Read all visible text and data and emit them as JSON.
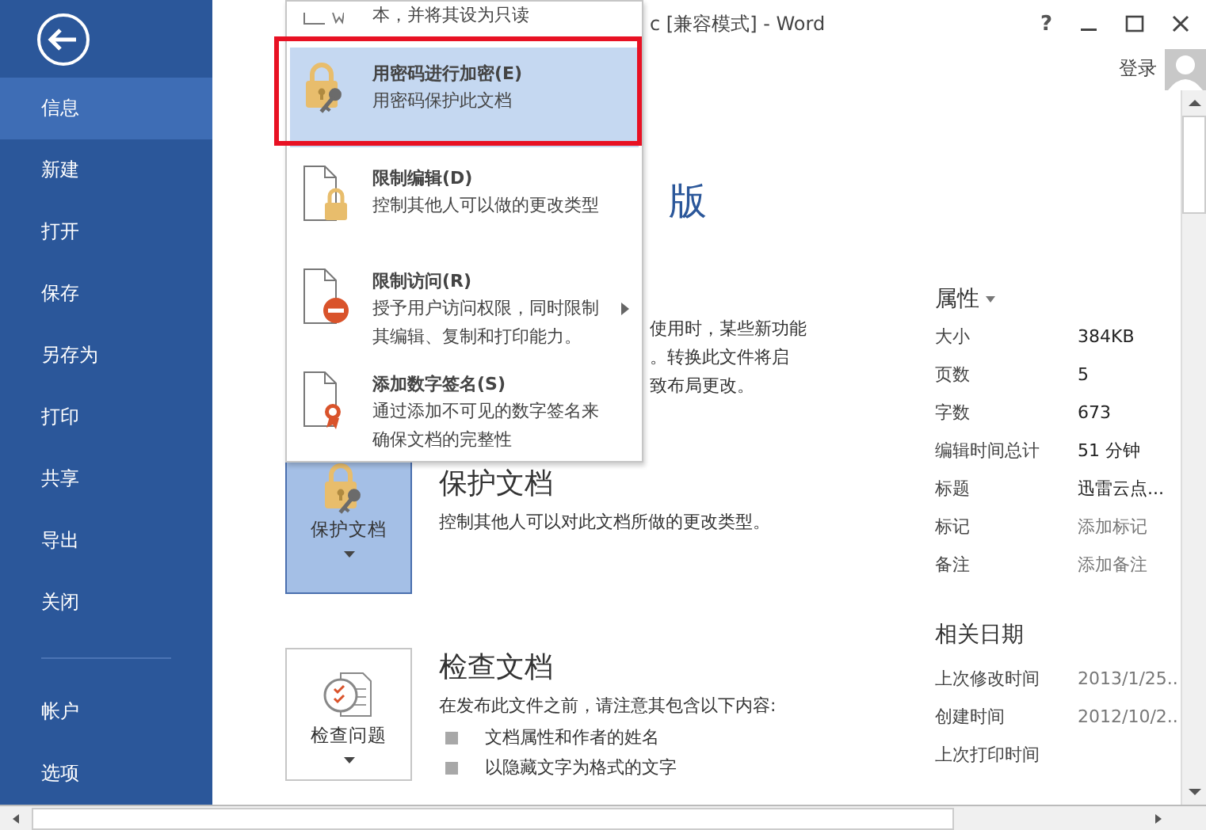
{
  "window": {
    "title": "c [兼容模式] - Word",
    "controls": [
      {
        "kind": "help",
        "label": "?"
      },
      {
        "kind": "minimize"
      },
      {
        "kind": "maximize"
      },
      {
        "kind": "close"
      }
    ],
    "sign_in": "登录"
  },
  "sidebar": {
    "items": [
      {
        "label": "信息",
        "selected": true
      },
      {
        "label": "新建",
        "selected": false
      },
      {
        "label": "打开",
        "selected": false
      },
      {
        "label": "保存",
        "selected": false
      },
      {
        "label": "另存为",
        "selected": false
      },
      {
        "label": "打印",
        "selected": false
      },
      {
        "label": "共享",
        "selected": false
      },
      {
        "label": "导出",
        "selected": false
      },
      {
        "label": "关闭",
        "selected": false
      },
      {
        "label": "帐户",
        "selected": false
      },
      {
        "label": "选项",
        "selected": false
      }
    ]
  },
  "heading_fragment": "版",
  "compat_text": [
    "使用时，某些新功能",
    "。转换此文件将启",
    "致布局更改。"
  ],
  "sections": [
    {
      "button": "保护文档",
      "selected": true,
      "title": "保护文档",
      "description": "控制其他人可以对此文档所做的更改类型。"
    },
    {
      "button": "检查问题",
      "selected": false,
      "title": "检查文档",
      "description": "在发布此文件之前，请注意其包含以下内容:",
      "bullets": [
        "文档属性和作者的姓名",
        "以隐藏文字为格式的文字"
      ]
    }
  ],
  "menu": {
    "items": [
      {
        "description": [
          "本，并将其设为只读"
        ],
        "selected": false,
        "submenu": false
      },
      {
        "title": "用密码进行加密(E)",
        "description": [
          "用密码保护此文档"
        ],
        "selected": true,
        "submenu": false
      },
      {
        "title": "限制编辑(D)",
        "description": [
          "控制其他人可以做的更改类型"
        ],
        "selected": false,
        "submenu": false
      },
      {
        "title": "限制访问(R)",
        "description": [
          "授予用户访问权限，同时限制",
          "其编辑、复制和打印能力。"
        ],
        "selected": false,
        "submenu": true
      },
      {
        "title": "添加数字签名(S)",
        "description": [
          "通过添加不可见的数字签名来",
          "确保文档的完整性"
        ],
        "selected": false,
        "submenu": false
      }
    ]
  },
  "properties": {
    "title": "属性",
    "rows": [
      {
        "label": "大小",
        "value": "384KB",
        "placeholder": false
      },
      {
        "label": "页数",
        "value": "5",
        "placeholder": false
      },
      {
        "label": "字数",
        "value": "673",
        "placeholder": false
      },
      {
        "label": "编辑时间总计",
        "value": "51 分钟",
        "placeholder": false
      },
      {
        "label": "标题",
        "value": "迅雷云点...",
        "placeholder": false
      },
      {
        "label": "标记",
        "value": "添加标记",
        "placeholder": true
      },
      {
        "label": "备注",
        "value": "添加备注",
        "placeholder": true
      }
    ]
  },
  "related_dates": {
    "title": "相关日期",
    "rows": [
      {
        "label": "上次修改时间",
        "value": "2013/1/25.."
      },
      {
        "label": "创建时间",
        "value": "2012/10/2.."
      },
      {
        "label": "上次打印时间"
      }
    ]
  }
}
